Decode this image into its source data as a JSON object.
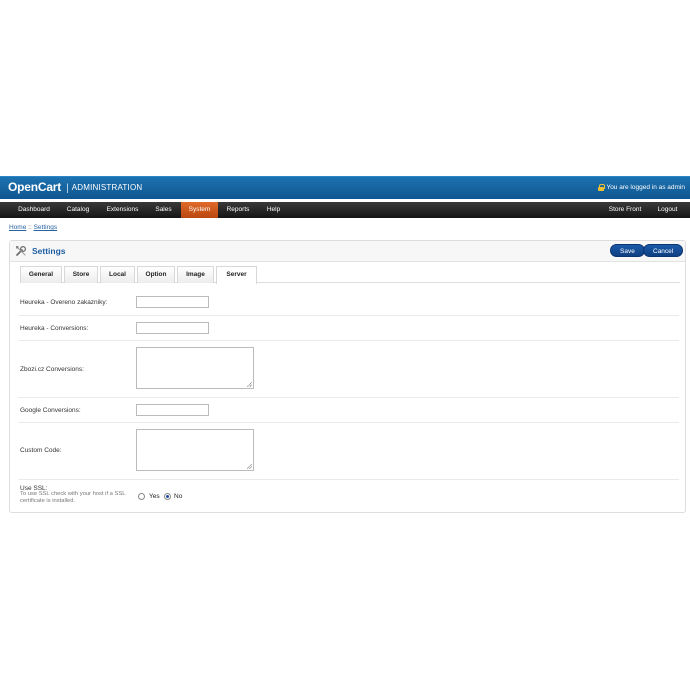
{
  "header": {
    "brand": "OpenCart",
    "separator": "|",
    "admin_label": "ADMINISTRATION",
    "login_text": "You are logged in as admin"
  },
  "menu": {
    "items": [
      {
        "label": "Dashboard",
        "active": false
      },
      {
        "label": "Catalog",
        "active": false
      },
      {
        "label": "Extensions",
        "active": false
      },
      {
        "label": "Sales",
        "active": false
      },
      {
        "label": "System",
        "active": true
      },
      {
        "label": "Reports",
        "active": false
      },
      {
        "label": "Help",
        "active": false
      }
    ],
    "right_items": [
      {
        "label": "Store Front"
      },
      {
        "label": "Logout"
      }
    ]
  },
  "breadcrumb": {
    "home": "Home",
    "separator": " :: ",
    "current": "Settings"
  },
  "page": {
    "title": "Settings",
    "save_label": "Save",
    "cancel_label": "Cancel"
  },
  "tabs": [
    {
      "label": "General",
      "selected": false
    },
    {
      "label": "Store",
      "selected": false
    },
    {
      "label": "Local",
      "selected": false
    },
    {
      "label": "Option",
      "selected": false
    },
    {
      "label": "Image",
      "selected": false
    },
    {
      "label": "Server",
      "selected": true
    }
  ],
  "form": {
    "heureka_overeno_label": "Heureka - Overeno zakazniky:",
    "heureka_overeno_value": "",
    "heureka_conversions_label": "Heureka - Conversions:",
    "heureka_conversions_value": "",
    "zbozi_conversions_label": "Zbozi.cz Conversions:",
    "zbozi_conversions_value": "",
    "google_conversions_label": "Google Conversions:",
    "google_conversions_value": "",
    "custom_code_label": "Custom Code:",
    "custom_code_value": "",
    "ssl_label": "Use SSL:",
    "ssl_help": "To use SSL check with your host if a SSL certificate is installed.",
    "ssl_yes": "Yes",
    "ssl_no": "No",
    "ssl_selected": "No"
  },
  "colors": {
    "header_blue": "#1566a3",
    "menu_active_orange": "#d45a1d",
    "button_blue": "#1b5aa8",
    "title_blue": "#1f5ea3"
  }
}
